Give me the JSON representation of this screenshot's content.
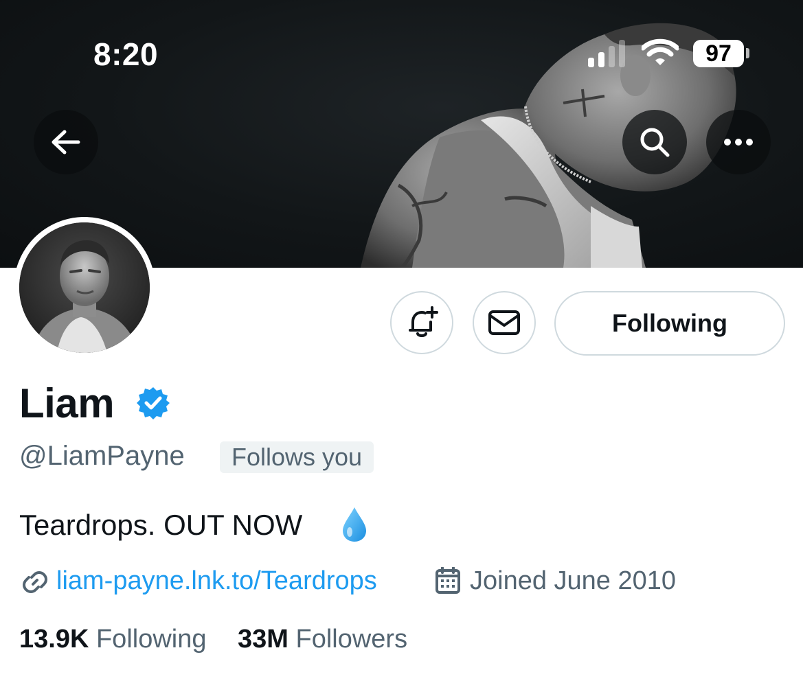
{
  "status_bar": {
    "time": "8:20",
    "battery": "97",
    "icons": [
      "signal-icon",
      "wifi-icon",
      "battery-icon"
    ]
  },
  "header": {
    "icons": [
      "back-arrow-icon",
      "search-icon",
      "more-icon"
    ]
  },
  "actions": {
    "icons": [
      "bell-plus-icon",
      "mail-icon"
    ],
    "following_label": "Following"
  },
  "profile": {
    "display_name": "Liam",
    "verified_icon": "verified-badge-icon",
    "handle": "@LiamPayne",
    "follows_you": "Follows you",
    "bio": "Teardrops. OUT NOW",
    "bio_emoji": "droplet-icon",
    "link_text": "liam-payne.lnk.to/Teardrops",
    "joined": "Joined June 2010"
  },
  "stats": {
    "following_count": "13.9K",
    "following_label": "Following",
    "followers_count": "33M",
    "followers_label": "Followers"
  },
  "colors": {
    "accent": "#1d9bf0",
    "text_primary": "#0f1419",
    "text_secondary": "#536471",
    "border": "#cfd9de",
    "badge_bg": "#eff3f4"
  }
}
